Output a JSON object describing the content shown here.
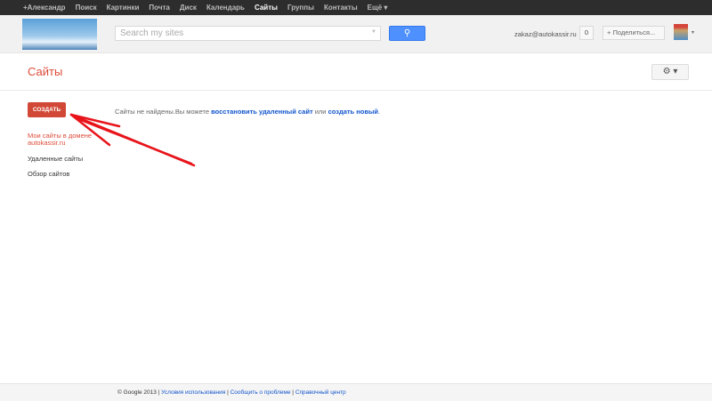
{
  "topbar": {
    "items": [
      "+Александр",
      "Поиск",
      "Картинки",
      "Почта",
      "Диск",
      "Календарь",
      "Сайты",
      "Группы",
      "Контакты",
      "Ещё ▾"
    ],
    "active": "Сайты"
  },
  "header": {
    "search_placeholder": "Search my sites",
    "search_icon": "search-icon",
    "email": "zakaz@autokassir.ru",
    "notifications": "0",
    "share": "+ Поделиться...",
    "avatar_caret": "▾"
  },
  "page": {
    "title": "Сайты",
    "settings_icon": "gear-icon",
    "create": "СОЗДАТЬ",
    "message_prefix": "Сайты не найдены.Вы можете ",
    "restore_link": "восстановить удаленный сайт",
    "message_mid": " или ",
    "create_link": "создать новый",
    "message_end": "."
  },
  "nav": {
    "my_sites_line1": "Мои сайты в домене",
    "my_sites_line2": "autokassir.ru",
    "deleted": "Удаленные сайты",
    "browse": "Обзор сайтов"
  },
  "footer": {
    "copyright": "© Google 2013",
    "sep": " | ",
    "terms": "Условия использования",
    "report": "Сообщить о проблеме",
    "help": "Справочный центр"
  },
  "colors": {
    "accent": "#dd4b39",
    "button": "#d14836",
    "link": "#1155cc",
    "search": "#4d90fe"
  }
}
